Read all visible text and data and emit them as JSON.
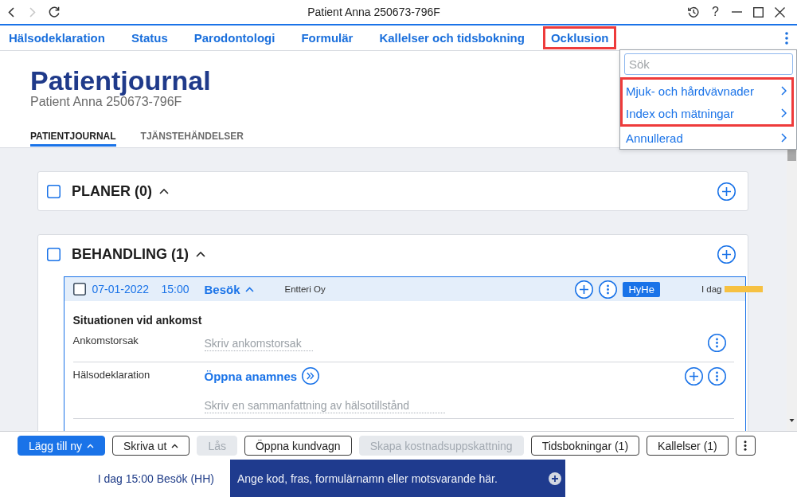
{
  "window": {
    "title": "Patient Anna 250673-796F",
    "help": "?"
  },
  "nav": {
    "items": [
      {
        "label": "Hälsodeklaration",
        "highlighted": false
      },
      {
        "label": "Status",
        "highlighted": false
      },
      {
        "label": "Parodontologi",
        "highlighted": false
      },
      {
        "label": "Formulär",
        "highlighted": false
      },
      {
        "label": "Kallelser och tidsbokning",
        "highlighted": false
      },
      {
        "label": "Ocklusion",
        "highlighted": true
      }
    ]
  },
  "menu": {
    "search": {
      "placeholder": "Sök"
    },
    "items": [
      {
        "label": "Mjuk- och hårdvävnader",
        "highlighted": true
      },
      {
        "label": "Index och mätningar",
        "highlighted": true
      },
      {
        "label": "Annullerad",
        "highlighted": false
      }
    ]
  },
  "header": {
    "title": "Patientjournal",
    "subtitle": "Patient Anna 250673-796F"
  },
  "tabs": [
    {
      "label": "PATIENTJOURNAL",
      "selected": true
    },
    {
      "label": "TJÄNSTEHÄNDELSER",
      "selected": false
    }
  ],
  "sections": [
    {
      "title": "PLANER (0)",
      "checked": false,
      "expanded": true
    },
    {
      "title": "BEHANDLING (1)",
      "checked": false,
      "expanded": true,
      "entries": [
        {
          "checked": false,
          "date": "07-01-2022",
          "time": "15:00",
          "type": "Besök",
          "expanded": true,
          "clinic": "Entteri Oy",
          "badge": "HyHe",
          "day": "I dag",
          "color": "#f6c142",
          "group": {
            "title": "Situationen vid ankomst",
            "fields": [
              {
                "kind": "text",
                "label": "Ankomstorsak",
                "placeholder": "Skriv ankomstorsak"
              },
              {
                "kind": "link",
                "label": "Hälsodeklaration",
                "link": "Öppna anamnes",
                "placeholder": "Skriv en sammanfattning av hälsotillstånd"
              }
            ]
          }
        }
      ]
    }
  ],
  "toolbar": {
    "buttons": [
      {
        "kind": "primary",
        "label": "Lägg till ny",
        "caret": true,
        "disabled": false
      },
      {
        "kind": "outline",
        "label": "Skriva ut",
        "caret": true,
        "disabled": false
      },
      {
        "kind": "outline",
        "label": "Lås",
        "caret": false,
        "disabled": true
      },
      {
        "kind": "outline",
        "label": "Öppna kundvagn",
        "caret": false,
        "disabled": false
      },
      {
        "kind": "outline",
        "label": "Skapa kostnadsuppskattning",
        "caret": false,
        "disabled": true
      },
      {
        "kind": "outline",
        "label": "Tidsbokningar (1)",
        "caret": false,
        "disabled": false
      },
      {
        "kind": "outline",
        "label": "Kallelser (1)",
        "caret": false,
        "disabled": false
      },
      {
        "kind": "more",
        "disabled": false
      }
    ]
  },
  "footer": {
    "current": "I dag 15:00 Besök (HH)",
    "command": {
      "placeholder": "Ange kod, fras, formulärnamn eller motsvarande här."
    }
  }
}
